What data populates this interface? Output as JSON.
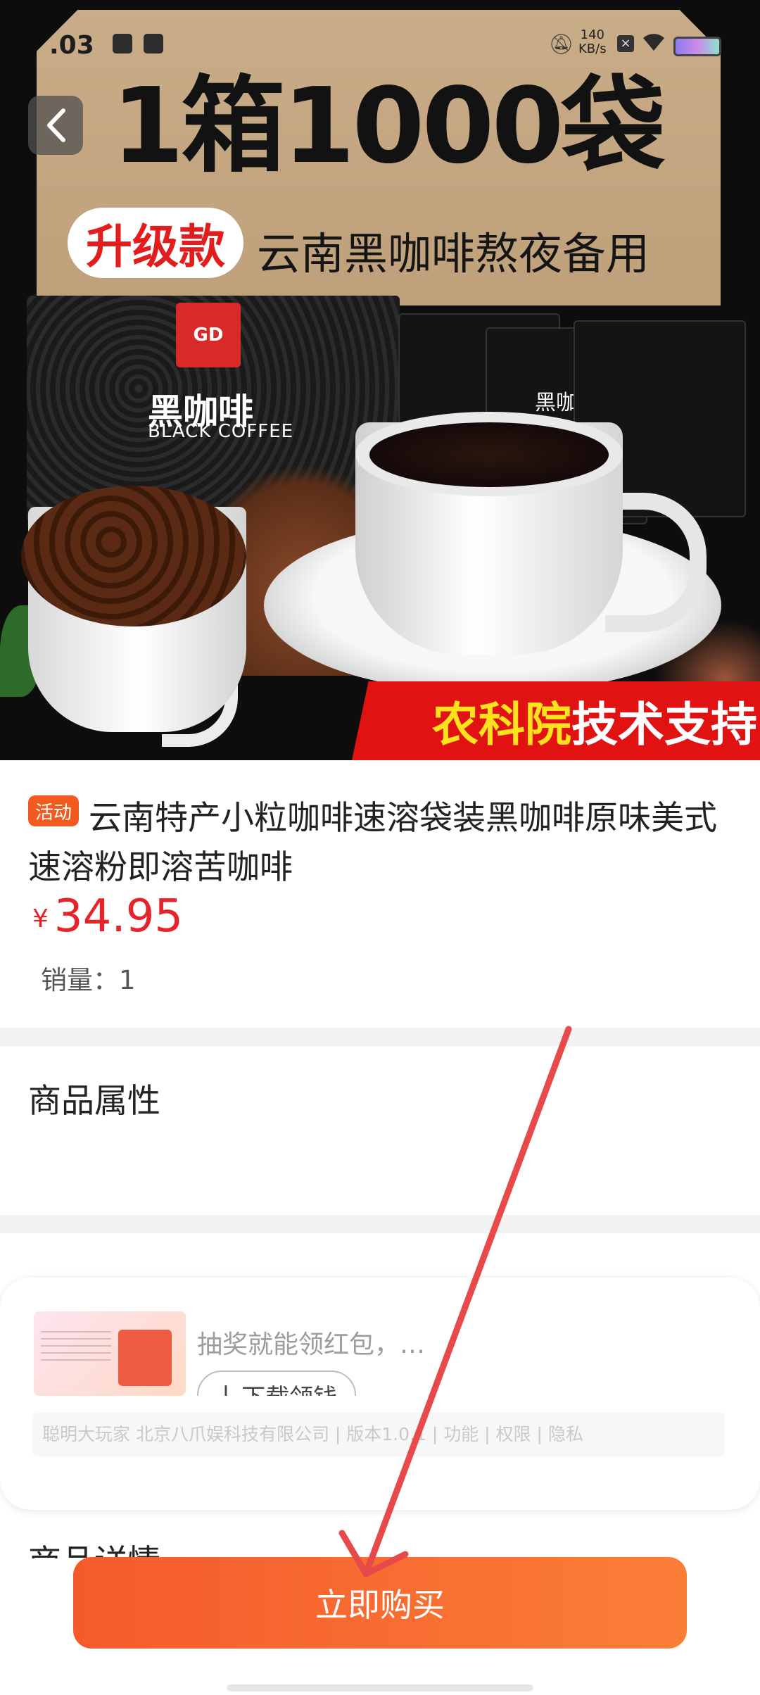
{
  "status_bar": {
    "time": ".03",
    "net_speed": "140",
    "net_unit": "KB/s"
  },
  "hero": {
    "headline": "1箱1000袋",
    "upgrade_tag": "升级款",
    "subheadline": "云南黑咖啡熬夜备用",
    "box_logo": "GD",
    "box_name": "黑咖啡",
    "box_name_en": "BLACK COFFEE",
    "sachet_label": "黑咖啡",
    "ribbon_yellow": "农科院",
    "ribbon_white": "技术支持"
  },
  "product": {
    "badge": "活动",
    "title": "云南特产小粒咖啡速溶袋装黑咖啡原味美式速溶粉即溶苦咖啡",
    "currency": "¥",
    "price": "34.95",
    "sales": "销量：1"
  },
  "sections": {
    "attributes_title": "商品属性",
    "details_title": "商品详情"
  },
  "ad": {
    "text": "抽奖就能领红包，…",
    "button_icon": "download-icon",
    "button_label": "下载领钱",
    "footer": "聪明大玩家  北京八爪娱科技有限公司 | 版本1.0.1 | 功能 | 权限 | 隐私"
  },
  "bottom_bar": {
    "buy_label": "立即购买"
  },
  "colors": {
    "price_red": "#e4232a",
    "buy_button": "#f76a30",
    "badge": "#f25a1f",
    "arrow": "#e84a4a"
  }
}
